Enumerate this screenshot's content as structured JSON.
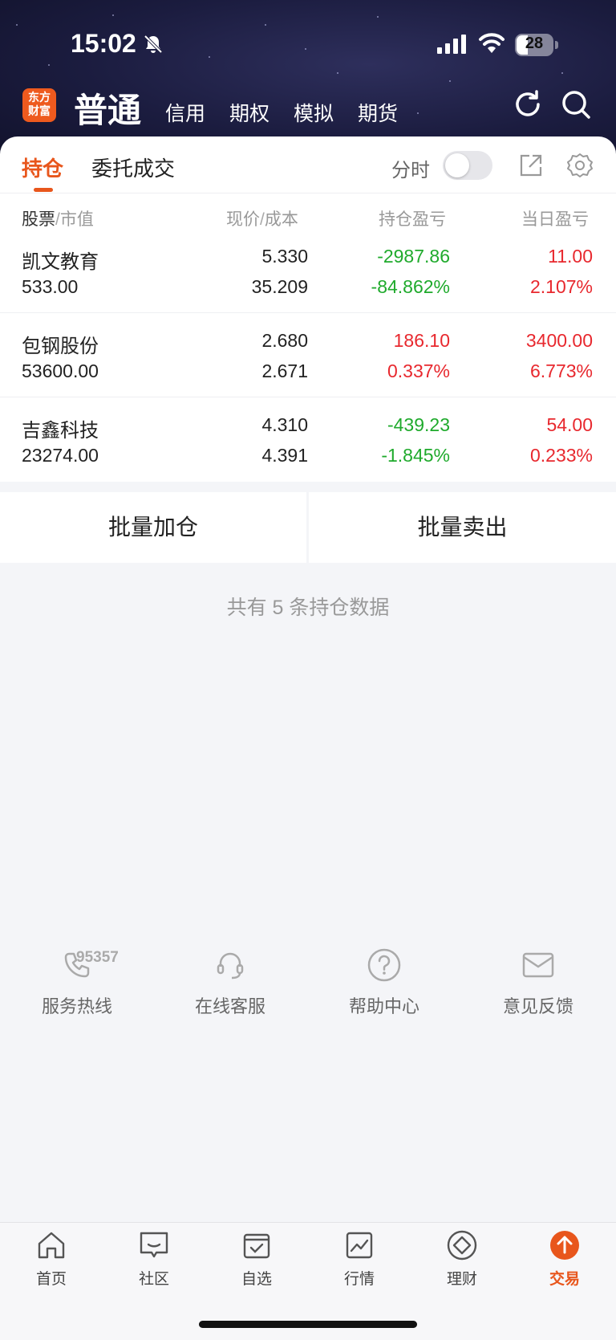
{
  "status_bar": {
    "time": "15:02",
    "battery": "28"
  },
  "header": {
    "logo_text": "东方财富",
    "mode": "普通",
    "tabs": [
      "信用",
      "期权",
      "模拟",
      "期货"
    ]
  },
  "tabs": {
    "holdings": "持仓",
    "orders": "委托成交",
    "fenshi": "分时"
  },
  "columns": {
    "stock": "股票",
    "market_value": "市值",
    "price": "现价",
    "cost": "成本",
    "position_pl": "持仓盈亏",
    "daily_pl": "当日盈亏"
  },
  "holdings": [
    {
      "name": "凯文教育",
      "market_value": "533.00",
      "price": "5.330",
      "cost": "35.209",
      "position_pl": "-2987.86",
      "position_pl_pct": "-84.862%",
      "daily_pl": "11.00",
      "daily_pl_pct": "2.107%"
    },
    {
      "name": "包钢股份",
      "market_value": "53600.00",
      "price": "2.680",
      "cost": "2.671",
      "position_pl": "186.10",
      "position_pl_pct": "0.337%",
      "daily_pl": "3400.00",
      "daily_pl_pct": "6.773%"
    },
    {
      "name": "吉鑫科技",
      "market_value": "23274.00",
      "price": "4.310",
      "cost": "4.391",
      "position_pl": "-439.23",
      "position_pl_pct": "-1.845%",
      "daily_pl": "54.00",
      "daily_pl_pct": "0.233%"
    }
  ],
  "actions": {
    "batch_add": "批量加仓",
    "batch_sell": "批量卖出"
  },
  "summary": "共有 5 条持仓数据",
  "services": {
    "hotline_number": "95357",
    "hotline": "服务热线",
    "online": "在线客服",
    "help": "帮助中心",
    "feedback": "意见反馈"
  },
  "bottom_nav": {
    "home": "首页",
    "community": "社区",
    "watchlist": "自选",
    "market": "行情",
    "wealth": "理财",
    "trade": "交易"
  },
  "colors": {
    "accent": "#e8561c",
    "rise": "#e8282e",
    "fall": "#1faa2c"
  }
}
